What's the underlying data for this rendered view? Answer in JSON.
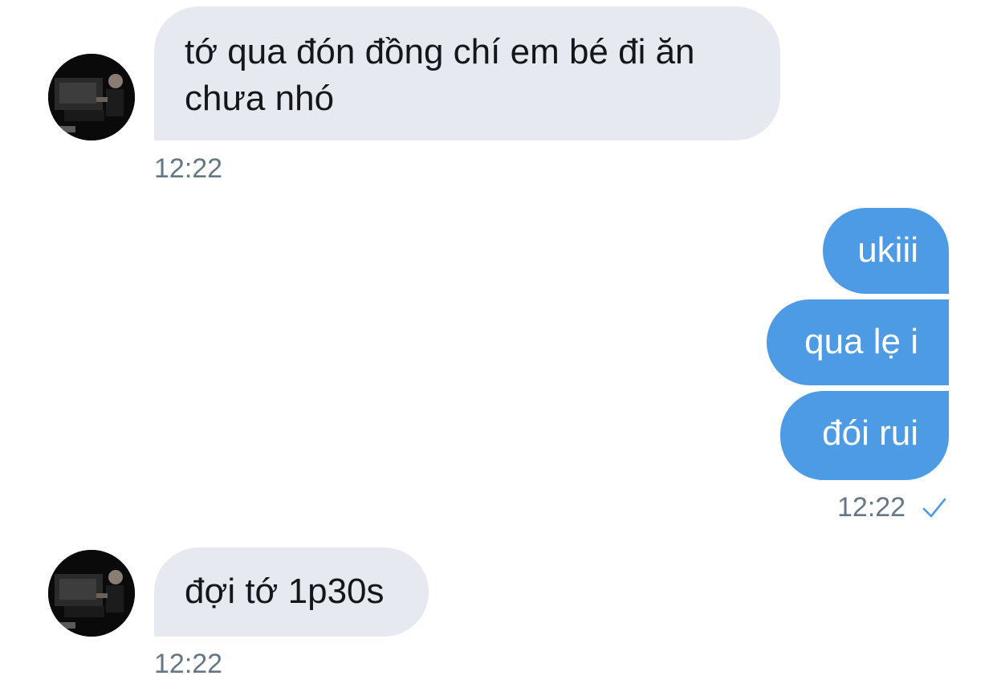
{
  "messages": [
    {
      "direction": "incoming",
      "text": "tớ qua đón đồng chí em bé đi ăn chưa nhó",
      "time": "12:22"
    },
    {
      "direction": "outgoing",
      "group": [
        "ukiii",
        "qua lẹ i",
        "đói rui"
      ],
      "time": "12:22",
      "status": "check-icon"
    },
    {
      "direction": "incoming",
      "text": "đợi tớ 1p30s",
      "time": "12:22"
    }
  ],
  "colors": {
    "incoming_bubble": "#e6e9ef",
    "outgoing_bubble": "#4e9be5",
    "timestamp": "#657786",
    "check": "#4e9be5"
  }
}
